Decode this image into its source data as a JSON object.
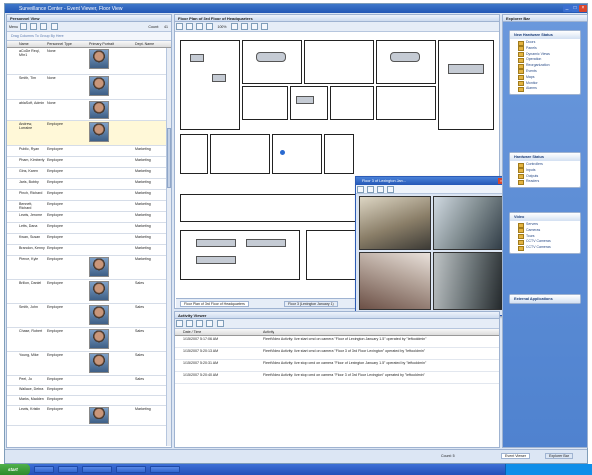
{
  "window": {
    "title": "Surveillance Center - Event Viewer, Floor View"
  },
  "personnel": {
    "header": "Personnel View",
    "toolbar_label": "Menu",
    "count_label": "Count:",
    "count_value": "41",
    "group_hint": "Drag Columns To Group By Here",
    "columns": [
      "Name",
      "Personnel Type",
      "Primary Portrait",
      "Dept. Name"
    ],
    "rows": [
      {
        "name": "aCoDe Reqi, Mhr1",
        "type": "None",
        "dept": "",
        "photo": true,
        "h": 27
      },
      {
        "name": "Smith, Tim",
        "type": "None",
        "dept": "",
        "photo": true,
        "h": 25
      },
      {
        "name": "ablaSoft, Admin",
        "type": "None",
        "dept": "",
        "photo": true,
        "h": 21
      },
      {
        "name": "Andrew, Lorraine",
        "type": "Employee",
        "dept": "",
        "photo": true,
        "h": 25
      },
      {
        "name": "Public, Ryan",
        "type": "Employee",
        "dept": "Marketing",
        "photo": false,
        "h": 11
      },
      {
        "name": "Pham, Kimberly",
        "type": "Employee",
        "dept": "Marketing",
        "photo": false,
        "h": 11
      },
      {
        "name": "Gins, Karen",
        "type": "Employee",
        "dept": "Marketing",
        "photo": false,
        "h": 11
      },
      {
        "name": "Jaris, Bobby",
        "type": "Employee",
        "dept": "Marketing",
        "photo": false,
        "h": 11
      },
      {
        "name": "Pinch, Richard",
        "type": "Employee",
        "dept": "Marketing",
        "photo": false,
        "h": 11
      },
      {
        "name": "Bennett, Richard",
        "type": "Employee",
        "dept": "Marketing",
        "photo": false,
        "h": 11
      },
      {
        "name": "Lewis, Jerome",
        "type": "Employee",
        "dept": "Marketing",
        "photo": false,
        "h": 11
      },
      {
        "name": "Letts, Dana",
        "type": "Employee",
        "dept": "Marketing",
        "photo": false,
        "h": 11
      },
      {
        "name": "Kwan, Susan",
        "type": "Employee",
        "dept": "Marketing",
        "photo": false,
        "h": 11
      },
      {
        "name": "Brandon, Kenny",
        "type": "Employee",
        "dept": "Marketing",
        "photo": false,
        "h": 11
      },
      {
        "name": "Pierce, Kyle",
        "type": "Employee",
        "dept": "Marketing",
        "photo": true,
        "h": 24
      },
      {
        "name": "Brillon, Daniel",
        "type": "Employee",
        "dept": "Sales",
        "photo": true,
        "h": 24
      },
      {
        "name": "Smith, John",
        "type": "Employee",
        "dept": "Sales",
        "photo": true,
        "h": 24
      },
      {
        "name": "Chase, Robert",
        "type": "Employee",
        "dept": "Sales",
        "photo": true,
        "h": 24
      },
      {
        "name": "Young, Mike",
        "type": "Employee",
        "dept": "Sales",
        "photo": true,
        "h": 24
      },
      {
        "name": "Peel, Jo",
        "type": "Employee",
        "dept": "Sales",
        "photo": false,
        "h": 10
      },
      {
        "name": "Wallace, Debra",
        "type": "Employee",
        "dept": "",
        "photo": false,
        "h": 10
      },
      {
        "name": "Marks, Madden",
        "type": "Employee",
        "dept": "",
        "photo": false,
        "h": 10
      },
      {
        "name": "Lewis, Kristin",
        "type": "Employee",
        "dept": "Marketing",
        "photo": true,
        "h": 20
      }
    ]
  },
  "floorplan": {
    "header": "Floor Plan of 3rd Floor of Headquarters",
    "zoom": "100%",
    "tabs": [
      "Floor Plan of 3rd Floor of Headquarters",
      "Floor 3 (Lexington January 1)"
    ]
  },
  "video": {
    "title": "Floor 3 of Lexington Jan..."
  },
  "activity": {
    "header": "Activity Viewer",
    "columns": [
      "Date / Time",
      "Activity"
    ],
    "rows": [
      {
        "time": "1/15/2007 5:17:06 AM",
        "text": "FleetVideo Activity: live start cmd on camera \"Floor of Lexington January 1.5\" operated by \"leftooldmin\""
      },
      {
        "time": "1/15/2007 5:20:13 AM",
        "text": "FleetVideo Activity: live start cmd on camera \"Floor 3 of 3rd Floor Lexington\" operated by \"leftooldmin\""
      },
      {
        "time": "1/15/2007 5:20:31 AM",
        "text": "FleetVideo Activity: live stop cmd on camera \"Floor of Lexington January 1.5\" operated by \"leftooldmin\""
      },
      {
        "time": "1/15/2007 5:20:40 AM",
        "text": "FleetVideo Activity: live stop cmd on camera \"Floor 3 of 3rd Floor Lexington\" operated by \"leftooldmin\""
      }
    ]
  },
  "explorer": {
    "header": "Explorer Bar",
    "sections": [
      {
        "title": "New Hardware Status",
        "items": [
          "Doors",
          "Panels",
          "Dynamic Views",
          "Operation",
          "Reorganization",
          "Events",
          "Maps",
          "Monitor",
          "Alarms"
        ]
      },
      {
        "title": "Hardware Status",
        "items": [
          "Controllers",
          "Inputs",
          "Outputs",
          "Readers"
        ]
      },
      {
        "title": "Video",
        "items": [
          "Servers",
          "Cameras",
          "Tours",
          "CCTV Cameras",
          "CCTV Cameras"
        ]
      },
      {
        "title": "External Applications",
        "items": []
      }
    ]
  },
  "statusbar": {
    "left": "Count: 5",
    "tab1": "Event Viewer",
    "tab2": "Explorer Bar"
  },
  "taskbar": {
    "start": "start",
    "tasks": [
      "",
      "",
      "",
      "",
      ""
    ]
  }
}
